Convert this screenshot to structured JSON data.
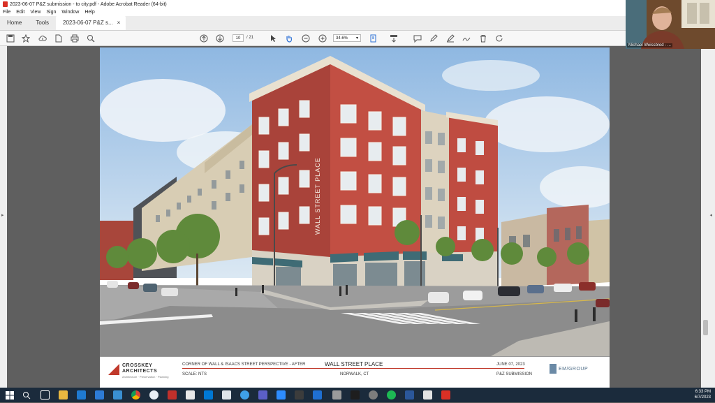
{
  "window": {
    "title": "2023-06-07 P&Z submission - to city.pdf - Adobe Acrobat Reader (64-bit)"
  },
  "menu": [
    "File",
    "Edit",
    "View",
    "Sign",
    "Window",
    "Help"
  ],
  "tabs": {
    "home": "Home",
    "tools": "Tools",
    "document": "2023-06-07 P&Z s...",
    "close": "×"
  },
  "toolbar": {
    "page_current": "10",
    "page_total": "/ 21",
    "zoom": "34.6%"
  },
  "titleblock": {
    "firm_line1": "CROSSKEY",
    "firm_line2": "ARCHITECTS",
    "firm_tagline": "Architecture · Preservation · Planning",
    "drawing_title": "CORNER OF WALL & ISAACS STREET PERSPECTIVE - AFTER",
    "scale": "SCALE: NTS",
    "project": "WALL STREET PLACE",
    "location": "NORWALK, CT",
    "date": "JUNE 07, 2023",
    "submission": "P&Z SUBMISSION",
    "partner_logo": "EM/GROUP"
  },
  "rendering": {
    "building_sign": "WALL STREET PLACE"
  },
  "video": {
    "participant": "Michael Weissbrod - ..."
  },
  "clock": {
    "time": "6:33 PM",
    "date": "6/7/2023"
  },
  "colors": {
    "brick": "#b5473c",
    "sky": "#9fc3e6",
    "awning": "#3f6b75",
    "taskbar": "#1b2b3c",
    "acrobat_red": "#d93025"
  }
}
